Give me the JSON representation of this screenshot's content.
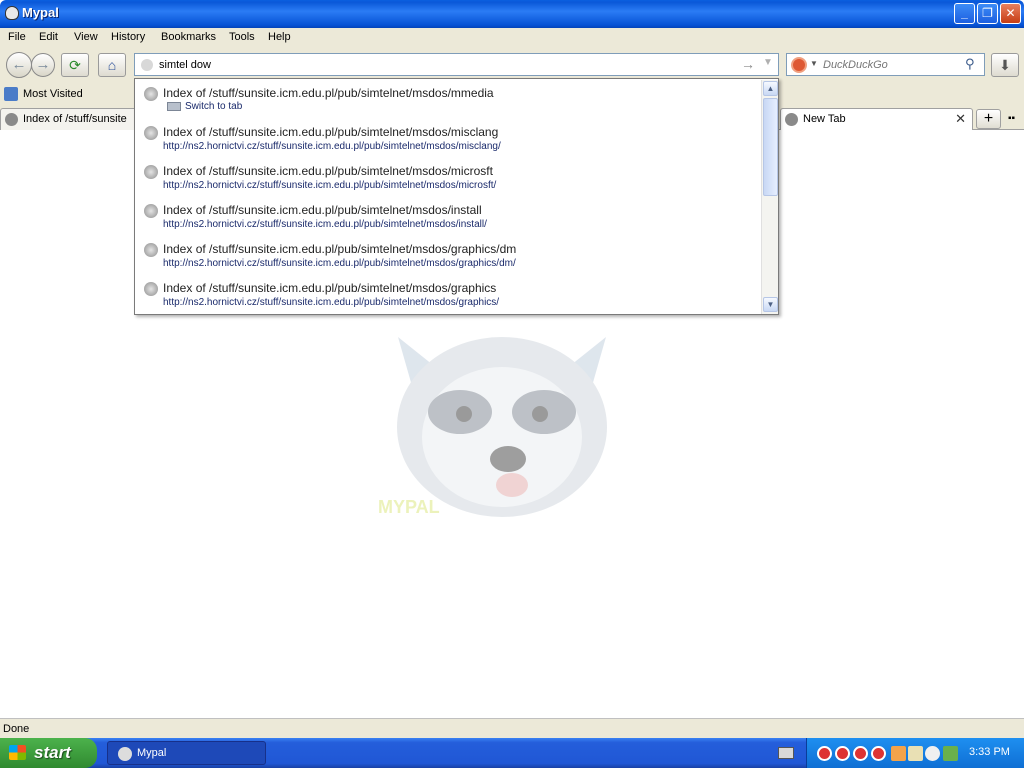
{
  "window": {
    "title": "Mypal",
    "minimize": "_",
    "maximize": "❐",
    "close": "✕"
  },
  "menu": [
    "File",
    "Edit",
    "View",
    "History",
    "Bookmarks",
    "Tools",
    "Help"
  ],
  "nav": {
    "back_glyph": "←",
    "forward_glyph": "→",
    "reload_glyph": "⟳",
    "home_glyph": "⌂",
    "url_value": "simtel dow",
    "go_glyph": "→",
    "dropdown_glyph": "▼",
    "search_placeholder": "DuckDuckGo",
    "search_engine_icon": "duckduckgo-icon",
    "search_glyph": "⚲",
    "download_glyph": "⬇"
  },
  "bookmarks": {
    "most_visited": "Most Visited"
  },
  "tabs": [
    {
      "label": "Index of /stuff/sunsite"
    },
    {
      "label": "New Tab",
      "close": "✕"
    }
  ],
  "tab_add": "+",
  "tab_list": "▪▪",
  "autocomplete": [
    {
      "title": "Index of /stuff/sunsite.icm.edu.pl/pub/simtelnet/msdos/mmedia",
      "switch": "Switch to tab"
    },
    {
      "title": "Index of /stuff/sunsite.icm.edu.pl/pub/simtelnet/msdos/misclang",
      "url": "http://ns2.hornictvi.cz/stuff/sunsite.icm.edu.pl/pub/simtelnet/msdos/misclang/"
    },
    {
      "title": "Index of /stuff/sunsite.icm.edu.pl/pub/simtelnet/msdos/microsft",
      "url": "http://ns2.hornictvi.cz/stuff/sunsite.icm.edu.pl/pub/simtelnet/msdos/microsft/"
    },
    {
      "title": "Index of /stuff/sunsite.icm.edu.pl/pub/simtelnet/msdos/install",
      "url": "http://ns2.hornictvi.cz/stuff/sunsite.icm.edu.pl/pub/simtelnet/msdos/install/"
    },
    {
      "title": "Index of /stuff/sunsite.icm.edu.pl/pub/simtelnet/msdos/graphics/dm",
      "url": "http://ns2.hornictvi.cz/stuff/sunsite.icm.edu.pl/pub/simtelnet/msdos/graphics/dm/"
    },
    {
      "title": "Index of /stuff/sunsite.icm.edu.pl/pub/simtelnet/msdos/graphics",
      "url": "http://ns2.hornictvi.cz/stuff/sunsite.icm.edu.pl/pub/simtelnet/msdos/graphics/"
    }
  ],
  "scroll": {
    "up": "▲",
    "down": "▼"
  },
  "mascot_brand": "MYPAL",
  "status": "Done",
  "taskbar": {
    "start": "start",
    "task_label": "Mypal",
    "clock": "3:33 PM"
  },
  "colors": {
    "titlebar": "#0a58d8",
    "chrome": "#ece9d8",
    "taskbar": "#245edb",
    "start": "#308a30",
    "link": "#1a2a6b"
  }
}
